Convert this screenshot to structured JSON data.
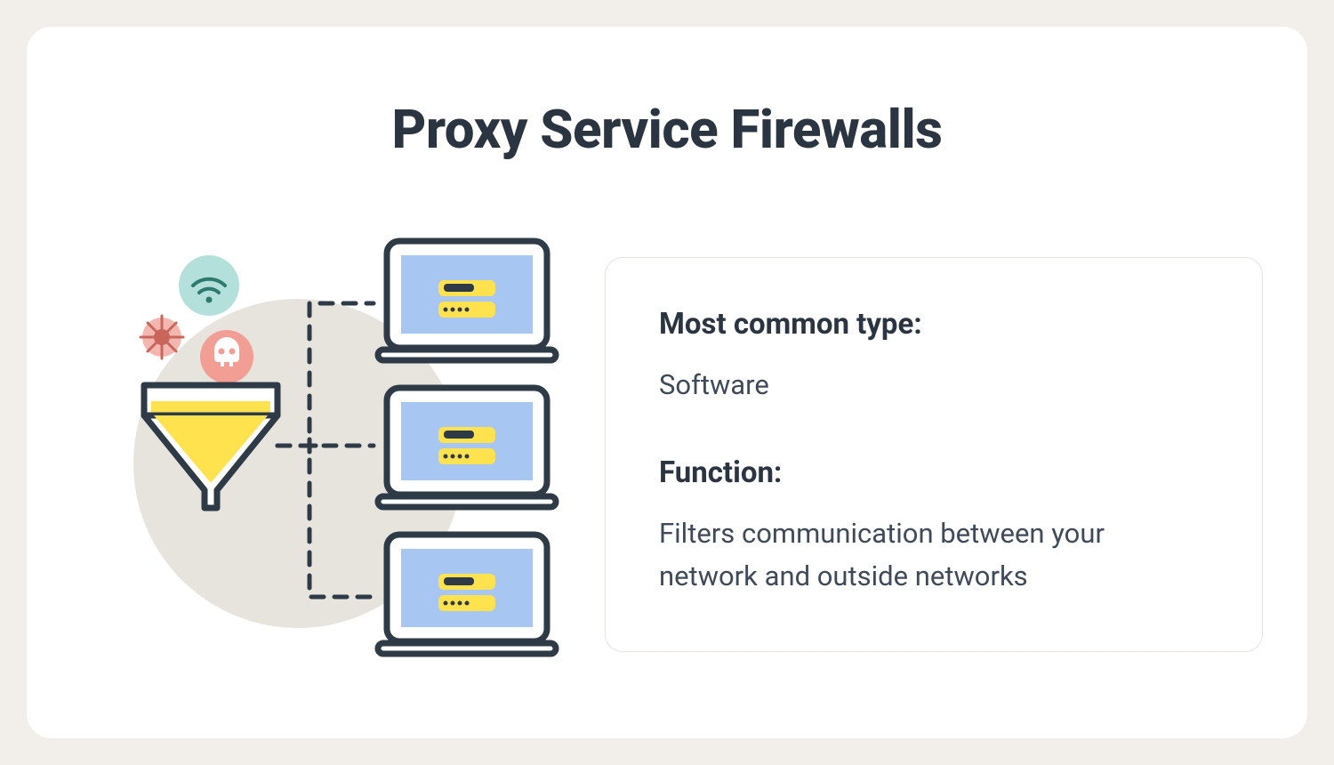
{
  "title": "Proxy Service Firewalls",
  "info": {
    "type_label": "Most common type:",
    "type_value": "Software",
    "function_label": "Function:",
    "function_value": "Filters communication between your network and outside networks"
  },
  "illustration": {
    "threats": [
      "wifi-signal",
      "virus",
      "skull"
    ],
    "funnel": "filter-funnel",
    "endpoints": [
      "laptop",
      "laptop",
      "laptop"
    ]
  },
  "colors": {
    "ink": "#2b3542",
    "ink_stroke": "#2f3a47",
    "accent_yellow": "#ffe24d",
    "accent_blue": "#a7c6f2",
    "soft_teal": "#b3e0db",
    "soft_pink": "#f4b7b0",
    "soft_red": "#f29e95",
    "bg_circle": "#e7e3dd"
  }
}
